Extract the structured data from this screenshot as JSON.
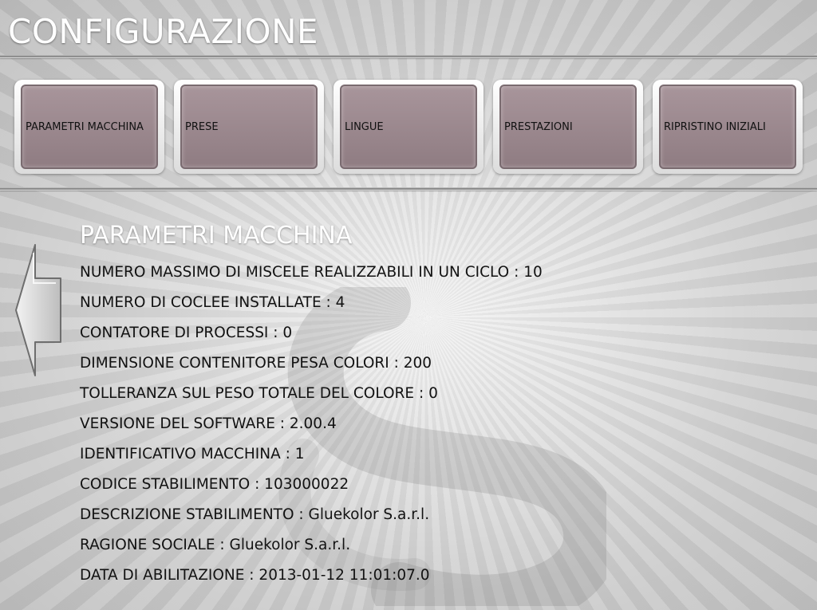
{
  "header": {
    "title": "CONFIGURAZIONE"
  },
  "tabs": [
    {
      "label": "PARAMETRI MACCHINA"
    },
    {
      "label": "PRESE"
    },
    {
      "label": "LINGUE"
    },
    {
      "label": "PRESTAZIONI"
    },
    {
      "label": "RIPRISTINO INIZIALI"
    }
  ],
  "back_icon": "left-arrow-icon",
  "section": {
    "title": "PARAMETRI MACCHINA",
    "params": [
      {
        "text": "NUMERO MASSIMO DI MISCELE REALIZZABILI IN UN CICLO : 10"
      },
      {
        "text": "NUMERO DI COCLEE INSTALLATE : 4"
      },
      {
        "text": "CONTATORE DI PROCESSI : 0"
      },
      {
        "text": "DIMENSIONE CONTENITORE PESA COLORI : 200"
      },
      {
        "text": "TOLLERANZA SUL PESO TOTALE DEL COLORE : 0"
      },
      {
        "text": "VERSIONE DEL SOFTWARE : 2.00.4"
      },
      {
        "text": "IDENTIFICATIVO MACCHINA : 1"
      },
      {
        "text": "CODICE STABILIMENTO : 103000022"
      },
      {
        "text": "DESCRIZIONE STABILIMENTO : Gluekolor S.a.r.l."
      },
      {
        "text": "RAGIONE SOCIALE : Gluekolor S.a.r.l."
      },
      {
        "text": "DATA DI ABILITAZIONE : 2013-01-12 11:01:07.0"
      }
    ]
  },
  "colors": {
    "tab_fill": "#9a868c",
    "title_text": "#ffffff",
    "body_text": "#121212"
  }
}
